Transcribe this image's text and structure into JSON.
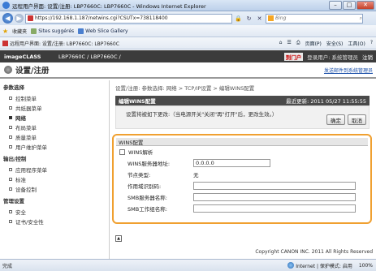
{
  "window": {
    "title": "远程用户界面: 设置/注册: LBP7660C: LBP7660C - Windows Internet Explorer"
  },
  "address": {
    "url": "https://192.168.1.187/netwins.cgi?CSUTx=738118400",
    "search_placeholder": "Bing"
  },
  "favorites": {
    "label": "收藏夹",
    "items": [
      "Sites suggérés",
      "Web Slice Gallery"
    ]
  },
  "command": {
    "tab_title": "远程用户界面: 设置/注册: LBP7660C: LBP7660C",
    "page": "页面(P)",
    "safety": "安全(S)",
    "tools": "工具(O)",
    "help": "?"
  },
  "app": {
    "brand": "imageCLASS",
    "model": "LBP7660C / LBP7660C /",
    "top_page": "到门户",
    "login": "登录用户: 系统管理员",
    "logout": "注销",
    "page_title": "设置/注册",
    "mail_link": "发送邮件到系统管理员"
  },
  "sidebar": {
    "sections": [
      {
        "title": "参数选择",
        "items": [
          "控制菜单",
          "共纸器菜单",
          "网络",
          "布局菜单",
          "质量菜单",
          "用户维护菜单"
        ]
      },
      {
        "title": "输出/控制",
        "items": [
          "应用程序菜单",
          "标准",
          "设备控制"
        ]
      },
      {
        "title": "管理设置",
        "items": [
          "安全",
          "证书/安全性"
        ]
      }
    ],
    "active": "网络"
  },
  "main": {
    "breadcrumb": "设置/注册: 参数选择: 网络 > TCP/IP设置 > 编辑WINS配置",
    "header_title": "编辑WINS配置",
    "last_updated": "最近更新: 2011 05/27 11:55:55",
    "note": "设置将被如下更改:（当电源开关\"关闭\"再\"打开\"后，更改生效。）",
    "ok": "确定",
    "cancel": "取消",
    "panel_title": "WINS配置",
    "wins_resolution": "WINS解析",
    "server_label": "WINS服务器地址:",
    "server_value": "0.0.0.0",
    "node_label": "节点类型:",
    "node_value": "无",
    "scope_label": "作用域识别码:",
    "smb_server_label": "SMB服务器名称:",
    "smb_group_label": "SMB工作组名称:"
  },
  "footer": {
    "copyright": "Copyright CANON INC. 2011 All Rights Reserved"
  },
  "status": {
    "done": "完成",
    "zone": "Internet | 保护模式: 启用",
    "zoom": "100%"
  }
}
